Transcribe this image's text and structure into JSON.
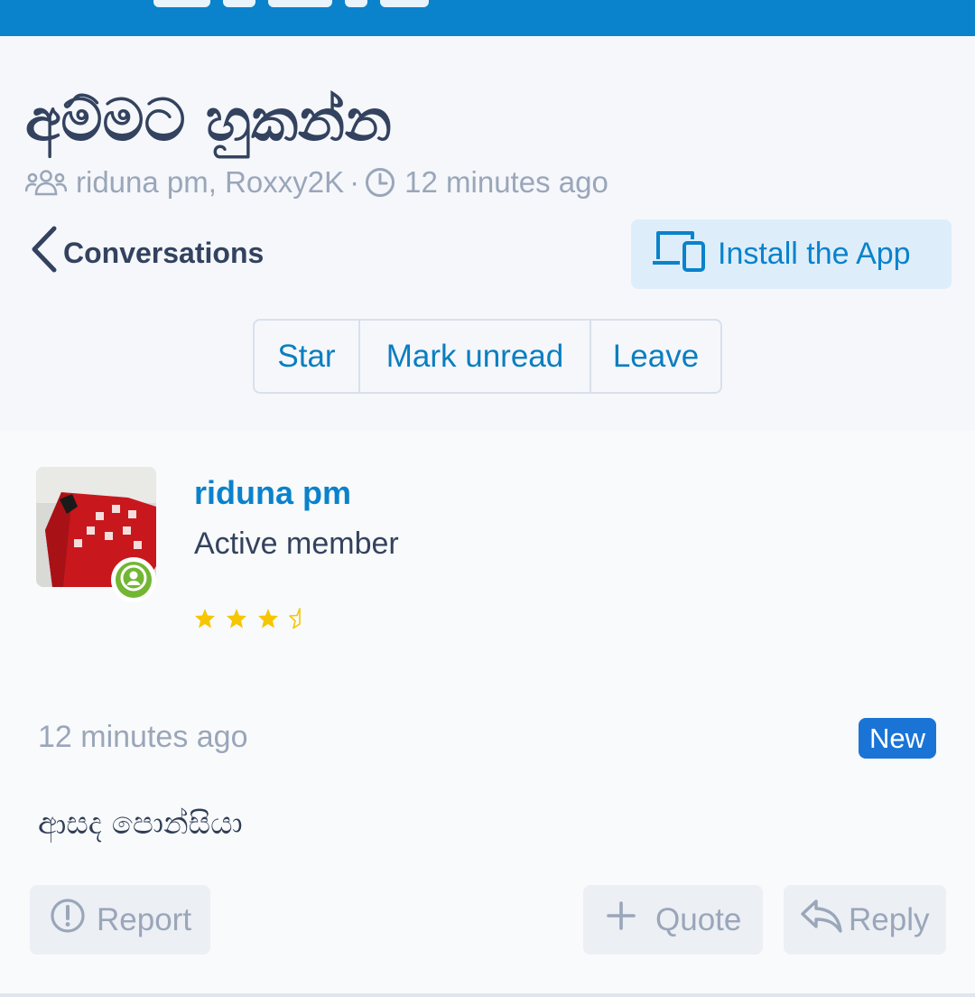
{
  "header": {
    "title": "අම්මට හුකන්න",
    "participants": "riduna pm, Roxxy2K",
    "separator": "·",
    "time": "12 minutes ago"
  },
  "nav": {
    "back_label": "Conversations",
    "install_label": "Install the App"
  },
  "actions": {
    "star": "Star",
    "mark_unread": "Mark unread",
    "leave": "Leave"
  },
  "message": {
    "username": "riduna pm",
    "user_title": "Active member",
    "rating_stars": 3.5,
    "rating_max": 4,
    "time": "12 minutes ago",
    "badge": "New",
    "body": "ආසද පොන්සියා",
    "report_label": "Report",
    "quote_label": "Quote",
    "reply_label": "Reply"
  },
  "colors": {
    "brand": "#0a82cc",
    "link": "#0a82cc",
    "badge": "#1a74d6",
    "online": "#72b633",
    "star": "#f7c600"
  }
}
